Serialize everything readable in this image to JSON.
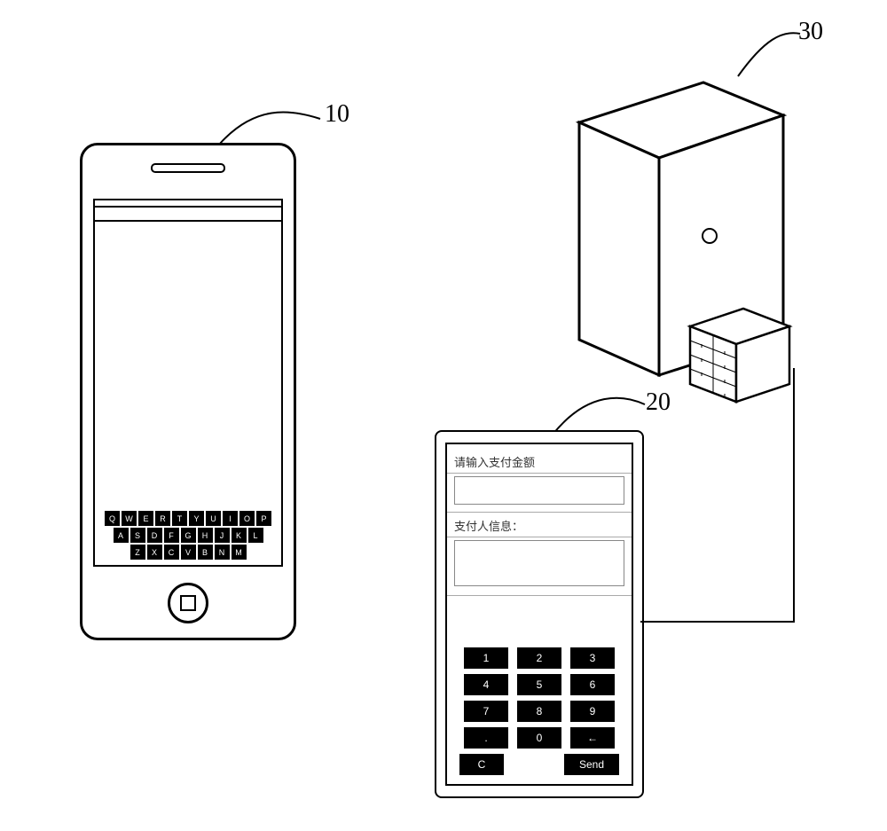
{
  "references": {
    "phone": "10",
    "terminal": "20",
    "server": "30"
  },
  "phone_keyboard": {
    "row1": [
      "Q",
      "W",
      "E",
      "R",
      "T",
      "Y",
      "U",
      "I",
      "O",
      "P"
    ],
    "row2": [
      "A",
      "S",
      "D",
      "F",
      "G",
      "H",
      "J",
      "K",
      "L"
    ],
    "row3": [
      "Z",
      "X",
      "C",
      "V",
      "B",
      "N",
      "M"
    ]
  },
  "terminal": {
    "label_amount": "请输入支付金额",
    "label_payer": "支付人信息：",
    "numpad": {
      "row1": [
        "1",
        "2",
        "3"
      ],
      "row2": [
        "4",
        "5",
        "6"
      ],
      "row3": [
        "7",
        "8",
        "9"
      ],
      "row4": [
        ".",
        "0",
        "←"
      ],
      "row5_left": "C",
      "row5_right": "Send"
    }
  }
}
